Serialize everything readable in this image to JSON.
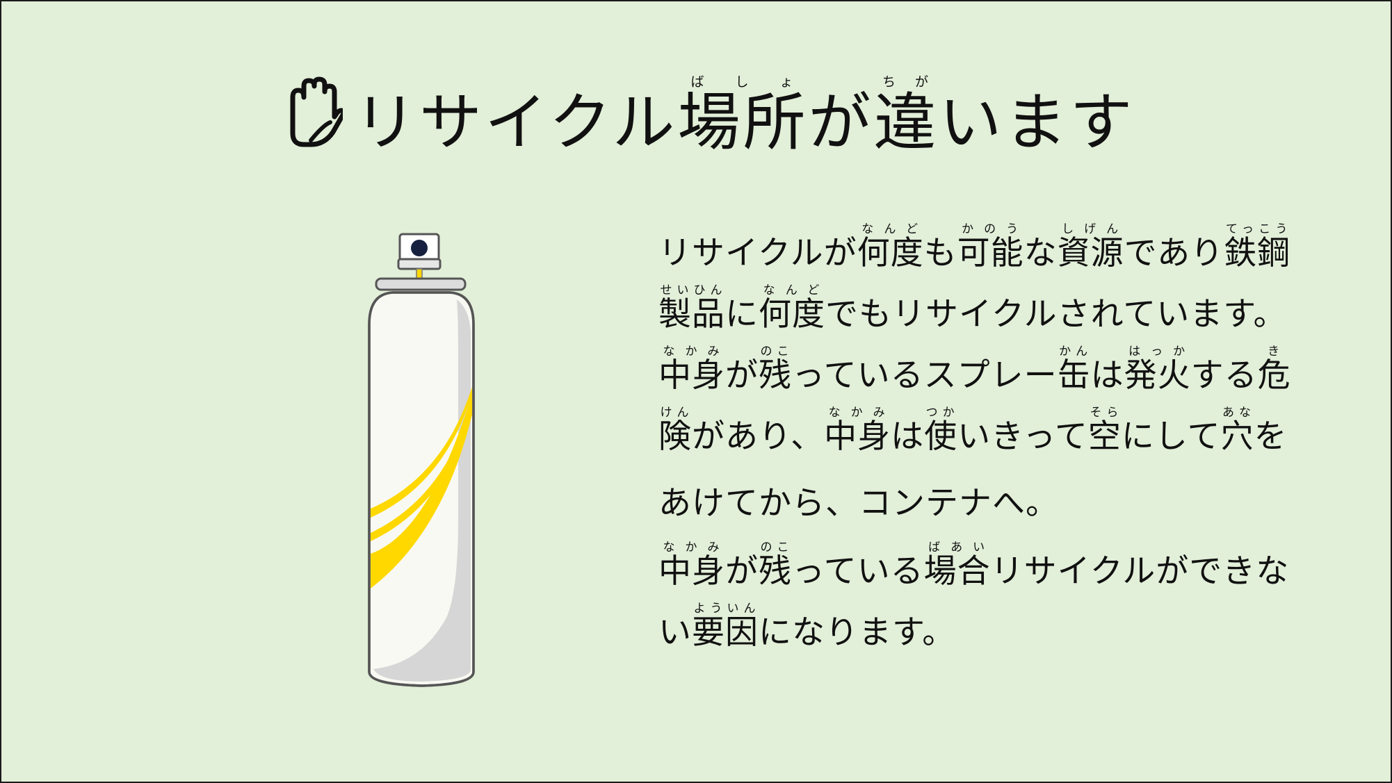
{
  "slide": {
    "title": {
      "icon": "hand-stop-icon",
      "segments": [
        {
          "text": "リサイクル"
        },
        {
          "text": "場所",
          "ruby": "ばしょ"
        },
        {
          "text": "が"
        },
        {
          "text": "違",
          "ruby": "ちが"
        },
        {
          "text": "います"
        }
      ]
    },
    "illustration": "spray-can-icon",
    "body_lines": [
      [
        {
          "text": "リサイクルが"
        },
        {
          "text": "何度",
          "ruby": "なんど"
        },
        {
          "text": "も"
        },
        {
          "text": "可能",
          "ruby": "かのう"
        },
        {
          "text": "な"
        },
        {
          "text": "資源",
          "ruby": "しげん"
        },
        {
          "text": "であり"
        },
        {
          "text": "鉄鋼",
          "ruby": "てっこう"
        }
      ],
      [
        {
          "text": "製品",
          "ruby": "せいひん"
        },
        {
          "text": "に"
        },
        {
          "text": "何度",
          "ruby": "なんど"
        },
        {
          "text": "でもリサイクルされています。"
        }
      ],
      [
        {
          "text": "中身",
          "ruby": "なかみ"
        },
        {
          "text": "が"
        },
        {
          "text": "残",
          "ruby": "のこ"
        },
        {
          "text": "っているスプレー"
        },
        {
          "text": "缶",
          "ruby": "かん"
        },
        {
          "text": "は"
        },
        {
          "text": "発火",
          "ruby": "はっか"
        },
        {
          "text": "する"
        },
        {
          "text": "危",
          "ruby": "き"
        }
      ],
      [
        {
          "text": "険",
          "ruby": "けん"
        },
        {
          "text": "があり、"
        },
        {
          "text": "中身",
          "ruby": "なかみ"
        },
        {
          "text": "は"
        },
        {
          "text": "使",
          "ruby": "つか"
        },
        {
          "text": "いきって"
        },
        {
          "text": "空",
          "ruby": "そら"
        },
        {
          "text": "にして"
        },
        {
          "text": "穴",
          "ruby": "あな"
        },
        {
          "text": "を"
        }
      ],
      [
        {
          "text": "あけてから、コンテナへ。"
        }
      ],
      [
        {
          "text": "中身",
          "ruby": "なかみ"
        },
        {
          "text": "が"
        },
        {
          "text": "残",
          "ruby": "のこ"
        },
        {
          "text": "っている"
        },
        {
          "text": "場合",
          "ruby": "ばあい"
        },
        {
          "text": "リサイクルができな"
        }
      ],
      [
        {
          "text": "い"
        },
        {
          "text": "要因",
          "ruby": "よういん"
        },
        {
          "text": "になります。"
        }
      ]
    ]
  },
  "colors": {
    "background": "#e2efd9",
    "text": "#111111",
    "can_body": "#f9f9f3",
    "can_shadow": "#d6d6d6",
    "can_stripe": "#ffd800",
    "nozzle_dot": "#16203f"
  }
}
